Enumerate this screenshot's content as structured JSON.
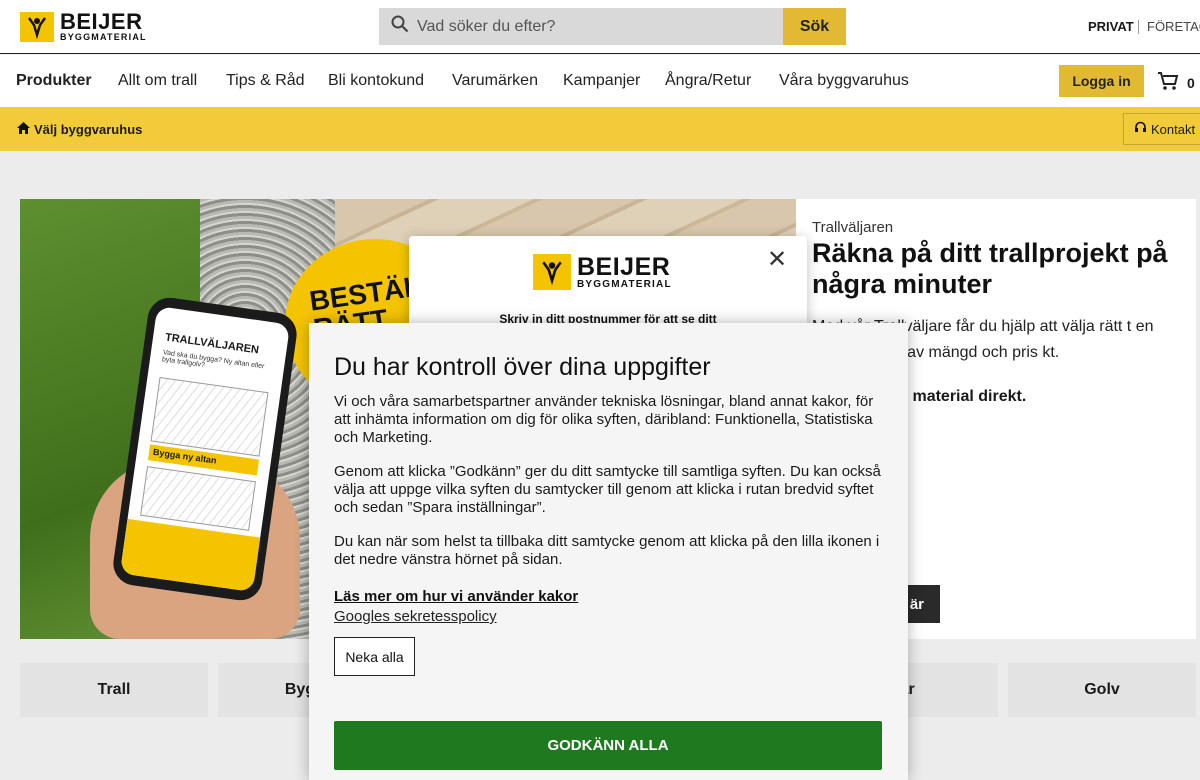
{
  "header": {
    "logo_name": "BEIJER",
    "logo_sub": "BYGGMATERIAL",
    "search_placeholder": "Vad söker du efter?",
    "search_button": "Sök",
    "segment_private": "PRIVAT",
    "segment_business": "FÖRETAG"
  },
  "nav": {
    "items": [
      "Produkter",
      "Allt om trall",
      "Tips & Råd",
      "Bli kontokund",
      "Varumärken",
      "Kampanjer",
      "Ångra/Retur",
      "Våra byggvaruhus"
    ],
    "login": "Logga in",
    "cart_count": "0"
  },
  "store_bar": {
    "choose_store": "Välj byggvaruhus",
    "contact": "Kontakt"
  },
  "hero": {
    "badge_text": "BESTÄL RÄTT",
    "phone_title": "TRALLVÄLJAREN",
    "phone_question": "Vad ska du bygga? Ny altan eller byta trallgolv?",
    "phone_option": "Bygga ny altan",
    "eyebrow": "Trallväljaren",
    "title": "Räkna på ditt trallprojekt på några minuter",
    "body": "Med vår Trallväljare får du hjälp att välja rätt t en uppskattning av mängd och pris kt.",
    "bold": "å rätt mängd material direkt.",
    "cta": "är"
  },
  "categories": [
    "Trall",
    "Byggm",
    "rar",
    "Golv"
  ],
  "postcode_modal": {
    "logo_name": "BEIJER",
    "logo_sub": "BYGGMATERIAL",
    "prompt": "Skriv in ditt postnummer för att se ditt"
  },
  "cookie": {
    "title": "Du har kontroll över dina uppgifter",
    "p1": "Vi och våra samarbetspartner använder tekniska lösningar, bland annat kakor, för att inhämta information om dig för olika syften, däribland: Funktionella, Statistiska och Marketing.",
    "p2": "Genom att klicka ”Godkänn” ger du ditt samtycke till samtliga syften. Du kan också välja att uppge vilka syften du samtycker till genom att klicka i rutan bredvid syftet och sedan ”Spara inställningar”.",
    "p3": "Du kan när som helst ta tillbaka ditt samtycke genom att klicka på den lilla ikonen i det nedre vänstra hörnet på sidan.",
    "link_cookies": "Läs mer om hur vi använder kakor",
    "link_google": "Googles sekretesspolicy",
    "deny": "Neka alla",
    "accept": "GODKÄNN ALLA"
  },
  "colors": {
    "brand_yellow": "#f5c400",
    "accent": "#e2b933",
    "bar_yellow": "#f2cb3b",
    "accept_green": "#1f7a1f"
  }
}
